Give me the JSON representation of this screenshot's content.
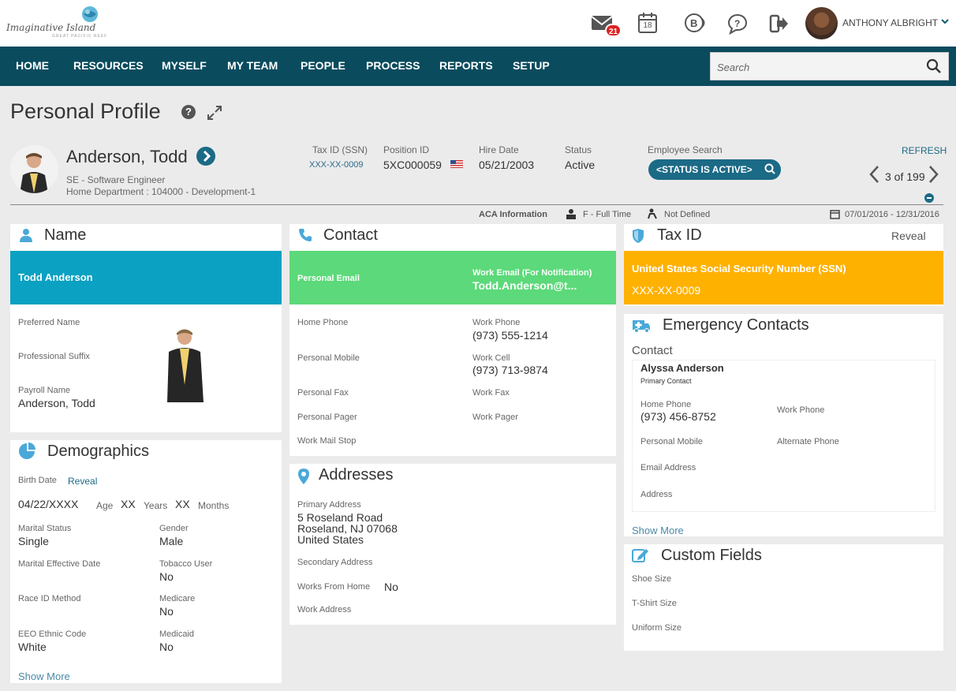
{
  "header": {
    "logo_text": "Imaginative Island",
    "logo_sub": "GREAT PACIFIC REEF",
    "mail_count": "21",
    "calendar_day": "18",
    "user_name": "ANTHONY ALBRIGHT"
  },
  "nav": {
    "items": [
      "HOME",
      "RESOURCES",
      "MYSELF",
      "MY TEAM",
      "PEOPLE",
      "PROCESS",
      "REPORTS",
      "SETUP"
    ],
    "search_placeholder": "Search"
  },
  "page": {
    "title": "Personal Profile"
  },
  "employee": {
    "name": "Anderson, Todd",
    "title": "SE - Software Engineer",
    "department": "Home Department : 104000 - Development-1",
    "tax_id_label": "Tax ID (SSN)",
    "tax_id_value": "XXX-XX-0009",
    "position_id_label": "Position ID",
    "position_id_value": "5XC000059",
    "hire_date_label": "Hire Date",
    "hire_date_value": "05/21/2003",
    "status_label": "Status",
    "status_value": "Active",
    "employee_search_label": "Employee Search",
    "employee_search_pill": "<STATUS IS ACTIVE>",
    "refresh": "REFRESH",
    "pager": "3 of 199"
  },
  "aca": {
    "label": "ACA Information",
    "full_time": "F - Full Time",
    "not_defined": "Not Defined",
    "date_range": "07/01/2016 - 12/31/2016"
  },
  "name_card": {
    "title": "Name",
    "band_name": "Todd Anderson",
    "preferred_name_label": "Preferred Name",
    "professional_suffix_label": "Professional Suffix",
    "payroll_name_label": "Payroll Name",
    "payroll_name_value": "Anderson, Todd",
    "band_color": "#0aa1c2"
  },
  "demographics": {
    "title": "Demographics",
    "birth_date_label": "Birth Date",
    "reveal": "Reveal",
    "birth_date_value": "04/22/XXXX",
    "age_label": "Age",
    "years_value": "XX",
    "years_label": "Years",
    "months_value": "XX",
    "months_label": "Months",
    "marital_status_label": "Marital Status",
    "marital_status_value": "Single",
    "gender_label": "Gender",
    "gender_value": "Male",
    "marital_effective_label": "Marital Effective Date",
    "tobacco_label": "Tobacco User",
    "tobacco_value": "No",
    "race_label": "Race ID Method",
    "medicare_label": "Medicare",
    "medicare_value": "No",
    "eeo_label": "EEO Ethnic Code",
    "eeo_value": "White",
    "medicaid_label": "Medicaid",
    "medicaid_value": "No",
    "show_more": "Show More"
  },
  "contact": {
    "title": "Contact",
    "personal_email_label": "Personal Email",
    "work_email_label": "Work Email (For Notification)",
    "work_email_value": "Todd.Anderson@t...",
    "home_phone_label": "Home Phone",
    "work_phone_label": "Work Phone",
    "work_phone_value": "(973) 555-1214",
    "personal_mobile_label": "Personal Mobile",
    "work_cell_label": "Work Cell",
    "work_cell_value": "(973) 713-9874",
    "personal_fax_label": "Personal Fax",
    "work_fax_label": "Work Fax",
    "personal_pager_label": "Personal Pager",
    "work_pager_label": "Work Pager",
    "work_mail_stop_label": "Work Mail Stop",
    "band_color": "#5cd97a"
  },
  "addresses": {
    "title": "Addresses",
    "primary_label": "Primary Address",
    "primary_line1": "5 Roseland Road",
    "primary_line2": "Roseland, NJ 07068",
    "primary_line3": "United States",
    "secondary_label": "Secondary Address",
    "works_from_home_label": "Works From Home",
    "works_from_home_value": "No",
    "work_address_label": "Work Address"
  },
  "tax": {
    "title": "Tax ID",
    "reveal": "Reveal",
    "band_label": "United States Social Security Number (SSN)",
    "band_value": "XXX-XX-0009",
    "band_color": "#ffb100"
  },
  "emergency": {
    "title": "Emergency Contacts",
    "contact_heading": "Contact",
    "contact_name": "Alyssa Anderson",
    "contact_role": "Primary Contact",
    "home_phone_label": "Home Phone",
    "home_phone_value": "(973) 456-8752",
    "work_phone_label": "Work Phone",
    "personal_mobile_label": "Personal Mobile",
    "alternate_phone_label": "Alternate Phone",
    "email_label": "Email Address",
    "address_label": "Address",
    "show_more": "Show More"
  },
  "custom": {
    "title": "Custom Fields",
    "shoe_size_label": "Shoe Size",
    "tshirt_size_label": "T-Shirt Size",
    "uniform_size_label": "Uniform Size"
  }
}
